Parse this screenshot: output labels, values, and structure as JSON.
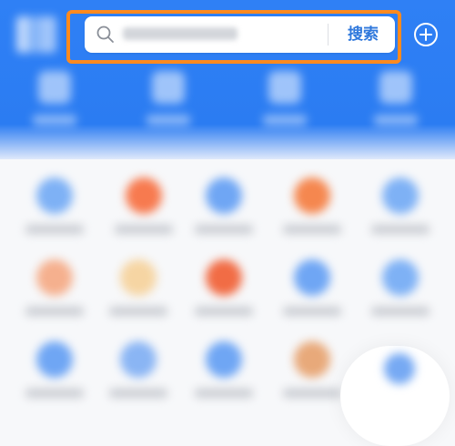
{
  "search": {
    "placeholder": "",
    "button_label": "搜索"
  },
  "colors": {
    "header_blue": "#2f80f5",
    "highlight_orange": "#ff8a1e",
    "search_button_text": "#2f78dc"
  },
  "icons": {
    "search": "magnifier-icon",
    "add": "plus-circle-icon"
  },
  "topnav": {
    "items": [
      {
        "label": ""
      },
      {
        "label": ""
      },
      {
        "label": ""
      },
      {
        "label": ""
      }
    ]
  },
  "grid": {
    "items": [
      {
        "label": "",
        "color": "#7eb1f5"
      },
      {
        "label": "",
        "color": "#f77a4f"
      },
      {
        "label": "",
        "color": "#6fa6f4"
      },
      {
        "label": "",
        "color": "#f5874f"
      },
      {
        "label": "",
        "color": "#7eb1f5"
      },
      {
        "label": "",
        "color": "#f5b08e"
      },
      {
        "label": "",
        "color": "#f6d5a3"
      },
      {
        "label": "",
        "color": "#f16c45"
      },
      {
        "label": "",
        "color": "#6fa6f4"
      },
      {
        "label": "",
        "color": "#7eb1f5"
      },
      {
        "label": "",
        "color": "#6fa6f4"
      },
      {
        "label": "",
        "color": "#8ab5f4"
      },
      {
        "label": "",
        "color": "#6fa6f4"
      },
      {
        "label": "",
        "color": "#e8a97a"
      },
      {
        "label": "",
        "color": "#76a9f3"
      }
    ]
  }
}
